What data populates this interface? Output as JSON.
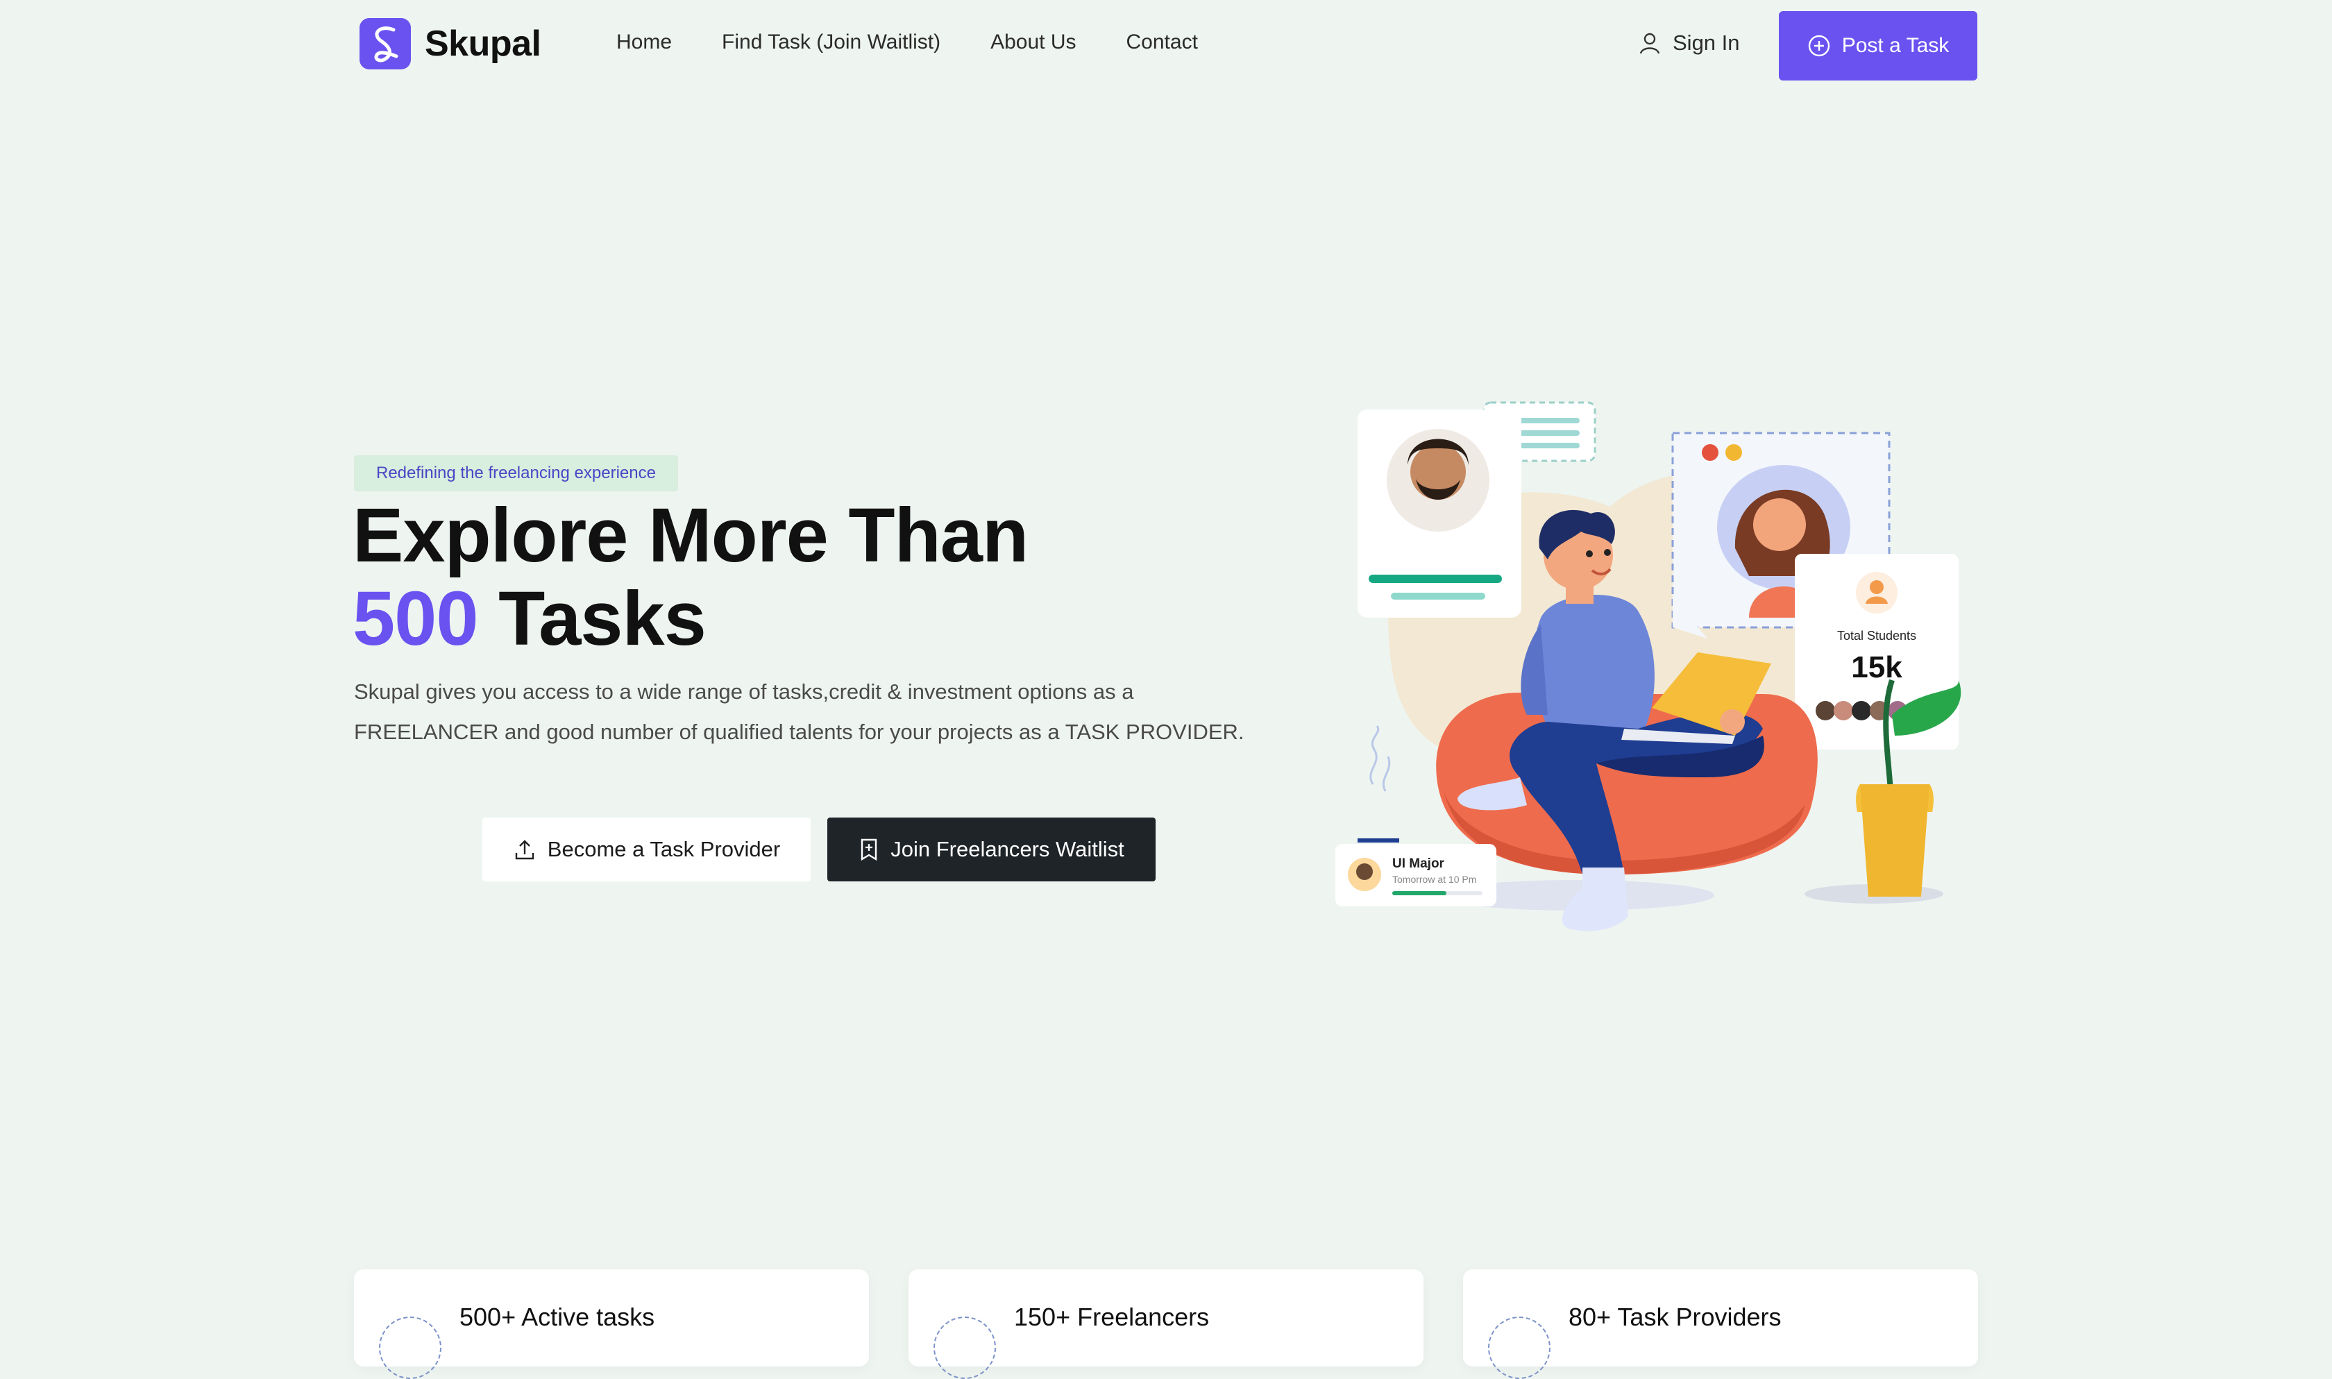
{
  "brand": {
    "name": "Skupal",
    "accent": "#6952f0"
  },
  "nav": {
    "items": [
      {
        "label": "Home"
      },
      {
        "label": "Find Task (Join Waitlist)"
      },
      {
        "label": "About Us"
      },
      {
        "label": "Contact"
      }
    ],
    "sign_in": "Sign In",
    "post_task": "Post a Task"
  },
  "hero": {
    "badge": "Redefining the freelancing experience",
    "title_line1": "Explore More Than",
    "title_accent": "500",
    "title_rest": " Tasks",
    "description": "Skupal gives you access to a wide range of tasks,credit & investment options as a FREELANCER and good number of qualified talents for your projects as a TASK PROVIDER.",
    "btn_provider": "Become a Task Provider",
    "btn_freelancer": "Join Freelancers Waitlist"
  },
  "illustration": {
    "students_label": "Total Students",
    "students_count": "15k",
    "class_name": "UI Major",
    "class_time": "Tomorrow at 10 Pm"
  },
  "stats": [
    {
      "label": "500+ Active tasks"
    },
    {
      "label": "150+ Freelancers"
    },
    {
      "label": "80+ Task Providers"
    }
  ]
}
